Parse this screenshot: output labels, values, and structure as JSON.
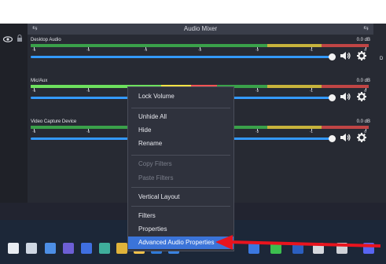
{
  "mixer": {
    "title": "Audio Mixer",
    "dock_left": "⇆",
    "dock_right": "⇆",
    "ticks": [
      "-6",
      "-5",
      "-4",
      "-3",
      "-2",
      "-1",
      "0"
    ]
  },
  "channels": [
    {
      "name": "Desktop Audio",
      "db": "0.0 dB",
      "level": 0.0
    },
    {
      "name": "Mic/Aux",
      "db": "0.0 dB",
      "level": 0.55
    },
    {
      "name": "Video Capture Device",
      "db": "0.0 dB",
      "level": 0.0
    }
  ],
  "right_panel": {
    "label": "D"
  },
  "context_menu": {
    "items": [
      {
        "label": "Lock Volume",
        "disabled": false
      },
      {
        "label": "Unhide All",
        "disabled": false
      },
      {
        "label": "Hide",
        "disabled": false
      },
      {
        "label": "Rename",
        "disabled": false
      },
      {
        "label": "Copy Filters",
        "disabled": true
      },
      {
        "label": "Paste Filters",
        "disabled": true
      },
      {
        "label": "Vertical Layout",
        "disabled": false
      },
      {
        "label": "Filters",
        "disabled": false
      },
      {
        "label": "Properties",
        "disabled": false
      },
      {
        "label": "Advanced Audio Properties",
        "disabled": false,
        "selected": true
      }
    ]
  },
  "colors": {
    "accent": "#3399ff",
    "menu_selected": "#3b74d9",
    "arrow": "#e8141e"
  },
  "taskbar": {
    "icons": [
      "start-icon",
      "search-icon",
      "task-view-icon",
      "teams-icon",
      "widgets-icon",
      "edge-icon",
      "chrome-icon",
      "files-icon",
      "mail-icon",
      "store-icon",
      "cortana-icon",
      "chat-icon",
      "word-icon",
      "acrobat-icon",
      "obs-icon",
      "discord-icon"
    ]
  }
}
